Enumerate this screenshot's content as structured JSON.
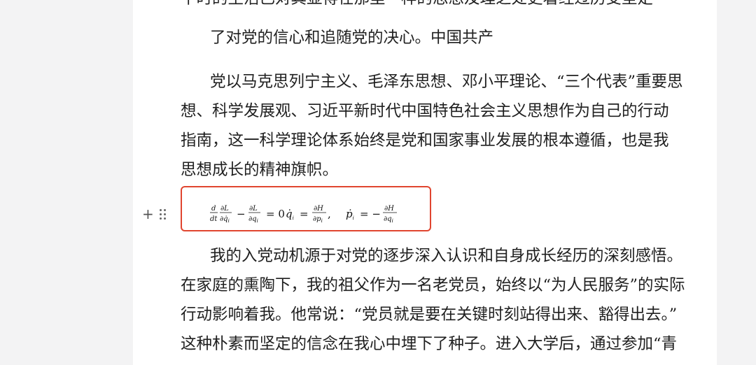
{
  "document": {
    "top_cut_line": "平时的生活已对其显得在那里一样的思想及理之处更着经过历受坚定",
    "paragraph_1": [
      "了对党的信心和追随党的决心。中国共产"
    ],
    "paragraph_2": [
      "党以马克思列宁主义、毛泽东思想、邓小平理论、“三个代表”重要思",
      "想、科学发展观、习近平新时代中国特色社会主义思想作为自己的行动",
      "指南，这一科学理论体系始终是党和国家事业发展的根本遵循，也是我",
      "思想成长的精神旗帜。"
    ],
    "paragraph_3": [
      "我的入党动机源于对党的逐步深入认识和自身成长经历的深刻感悟。",
      "在家庭的熏陶下，我的祖父作为一名老党员，始终以“为人民服务”的实际",
      "行动影响着我。他常说：“党员就是要在关键时刻站得出来、豁得出去。”",
      "这种朴素而坚定的信念在我心中埋下了种子。进入大学后，通过参加“青"
    ]
  },
  "formula": {
    "latex": "\\frac{d}{dt}\\frac{\\partial L}{\\partial \\dot q_i} - \\frac{\\partial L}{\\partial q_i} = 0 \\dot q_i = \\frac{\\partial H}{\\partial p_i}, \\quad \\dot p_i = -\\frac{\\partial H}{\\partial q_i}",
    "highlight_color": "#e0452f"
  },
  "block_controls": {
    "add": "+",
    "add_icon": "plus-icon",
    "drag_icon": "drag-handle-icon"
  }
}
